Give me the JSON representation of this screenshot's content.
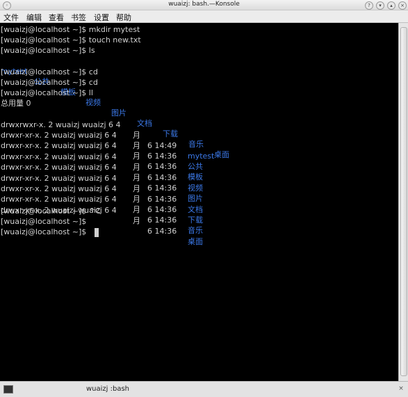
{
  "window": {
    "title": "wuaizj: bash.—Konsole"
  },
  "menu": [
    "文件",
    "编辑",
    "查看",
    "书签",
    "设置",
    "帮助"
  ],
  "terminal": {
    "prompt": "[wuaizj@localhost ~]$",
    "commands": [
      {
        "cmd": "mkdir mytest"
      },
      {
        "cmd": "touch new.txt"
      },
      {
        "cmd": "ls"
      }
    ],
    "ls_output": [
      "mytest",
      "公共",
      "模板",
      "视频",
      "图片",
      "文档",
      "下载",
      "音乐",
      "桌面"
    ],
    "commands2": [
      {
        "cmd": "cd"
      },
      {
        "cmd": "cd"
      },
      {
        "cmd": "ll"
      }
    ],
    "total": "总用量 0",
    "listing": [
      {
        "perm": "drwxrwxr-x. 2 wuaizj wuaizj 6 4",
        "month": "月",
        "time": "6 14:49",
        "name": "mytest"
      },
      {
        "perm": "drwxr-xr-x. 2 wuaizj wuaizj 6 4",
        "month": "月",
        "time": "6 14:36",
        "name": "公共"
      },
      {
        "perm": "drwxr-xr-x. 2 wuaizj wuaizj 6 4",
        "month": "月",
        "time": "6 14:36",
        "name": "模板"
      },
      {
        "perm": "drwxr-xr-x. 2 wuaizj wuaizj 6 4",
        "month": "月",
        "time": "6 14:36",
        "name": "视频"
      },
      {
        "perm": "drwxr-xr-x. 2 wuaizj wuaizj 6 4",
        "month": "月",
        "time": "6 14:36",
        "name": "图片"
      },
      {
        "perm": "drwxr-xr-x. 2 wuaizj wuaizj 6 4",
        "month": "月",
        "time": "6 14:36",
        "name": "文档"
      },
      {
        "perm": "drwxr-xr-x. 2 wuaizj wuaizj 6 4",
        "month": "月",
        "time": "6 14:36",
        "name": "下载"
      },
      {
        "perm": "drwxr-xr-x. 2 wuaizj wuaizj 6 4",
        "month": "月",
        "time": "6 14:36",
        "name": "音乐"
      },
      {
        "perm": "drwxr-xr-x. 2 wuaizj wuaizj 6 4",
        "month": "月",
        "time": "6 14:36",
        "name": "桌面"
      }
    ],
    "tail": [
      "^C",
      "",
      ""
    ],
    "colors": {
      "text": "#d0d0d0",
      "dir": "#3b78e7",
      "bg": "#000000"
    }
  },
  "tab": {
    "label": "wuaizj :bash"
  }
}
